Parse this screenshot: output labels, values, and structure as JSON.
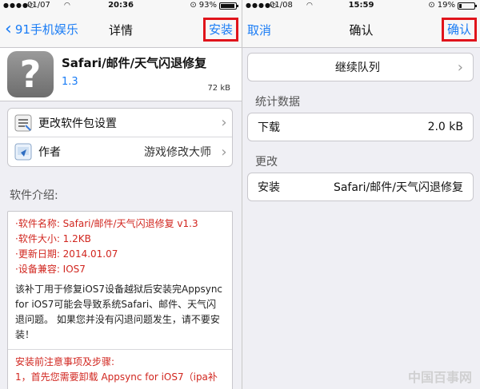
{
  "left": {
    "status": {
      "carrier": "01/07",
      "time": "20:36",
      "battery": "93%",
      "battery_level": 0.93
    },
    "nav": {
      "back_label": "91手机娱乐",
      "title": "详情",
      "action_label": "安装"
    },
    "app": {
      "icon_glyph": "?",
      "name": "Safari/邮件/天气闪退修复",
      "version": "1.3",
      "size": "72 kB"
    },
    "menu": [
      {
        "label": "更改软件包设置",
        "value": ""
      },
      {
        "label": "作者",
        "value": "游戏修改大师"
      }
    ],
    "section_title": "软件介绍:",
    "info": [
      "·软件名称: Safari/邮件/天气闪退修复 v1.3",
      "·软件大小: 1.2KB",
      "·更新日期: 2014.01.07",
      "·设备兼容: IOS7"
    ],
    "description": "该补丁用于修复iOS7设备越狱后安装完Appsync for iOS7可能会导致系统Safari、邮件、天气闪退问题。 如果您并没有闪退问题发生，请不要安装！",
    "steps_title": "安装前注意事项及步骤:",
    "steps_first": "1，首先您需要卸载 Appsync for iOS7（ipa补"
  },
  "right": {
    "status": {
      "carrier": "01/08",
      "time": "15:59",
      "battery": "19%",
      "battery_level": 0.19
    },
    "nav": {
      "cancel_label": "取消",
      "title": "确认",
      "action_label": "确认"
    },
    "continue_label": "继续队列",
    "stats_title": "统计数据",
    "download": {
      "label": "下载",
      "value": "2.0 kB"
    },
    "changes_title": "更改",
    "install": {
      "label": "安装",
      "value": "Safari/邮件/天气闪退修复"
    }
  },
  "watermark": "中国百事网"
}
